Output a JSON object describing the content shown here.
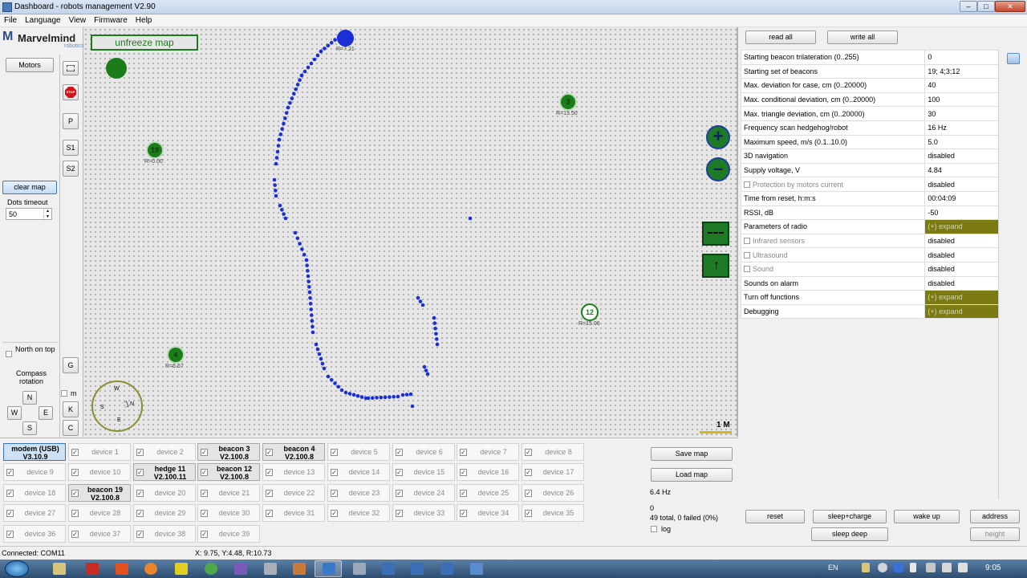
{
  "window": {
    "title": "Dashboard - robots management  V2.90",
    "min": "–",
    "max": "□",
    "close": "✕"
  },
  "menu": [
    "File",
    "Language",
    "View",
    "Firmware",
    "Help"
  ],
  "logo": {
    "m": "M",
    "name": "Marvelmind",
    "sub": "robotics"
  },
  "left": {
    "motors": "Motors",
    "stop": "STOP",
    "p": "P",
    "s1": "S1",
    "s2": "S2",
    "clear_map": "clear map",
    "dots_timeout_label": "Dots timeout",
    "dots_timeout_value": "50",
    "north_on_top": "North on top",
    "compass_rotation": "Compass rotation",
    "n": "N",
    "w": "W",
    "e": "E",
    "s": "S",
    "g": "G",
    "m": "m",
    "k": "K",
    "c": "C"
  },
  "map": {
    "unfreeze": "unfreeze map",
    "scale": "1 M",
    "compass": {
      "w": "W",
      "n": "N",
      "s": "S",
      "e": "E"
    },
    "beacons": [
      {
        "id": "19",
        "r": "R=0.00"
      },
      {
        "id": "3",
        "r": "R=13.50"
      },
      {
        "id": "4",
        "r": "R=6.67"
      },
      {
        "id": "12",
        "r": "R=15.06"
      }
    ],
    "hedge_r": "R=7.21"
  },
  "devices": {
    "modem": {
      "name": "modem (USB)",
      "ver": "V3.10.9"
    },
    "active": [
      {
        "name": "beacon 3",
        "ver": "V2.100.8"
      },
      {
        "name": "beacon 4",
        "ver": "V2.100.8"
      },
      {
        "name": "hedge 11",
        "ver": "V2.100.11"
      },
      {
        "name": "beacon 12",
        "ver": "V2.100.8"
      },
      {
        "name": "beacon 19",
        "ver": "V2.100.8"
      }
    ],
    "inactive": [
      "device 1",
      "device 2",
      "device 5",
      "device 6",
      "device 7",
      "device 8",
      "device 9",
      "device 10",
      "device 13",
      "device 14",
      "device 15",
      "device 16",
      "device 17",
      "device 18",
      "device 20",
      "device 21",
      "device 22",
      "device 23",
      "device 24",
      "device 25",
      "device 26",
      "device 27",
      "device 28",
      "device 29",
      "device 30",
      "device 31",
      "device 32",
      "device 33",
      "device 34",
      "device 35",
      "device 36",
      "device 37",
      "device 38",
      "device 39"
    ]
  },
  "mapctl": {
    "save": "Save map",
    "load": "Load map",
    "freq": "6.4 Hz",
    "count": "0",
    "stats": "49 total, 0 failed (0%)",
    "log": "log"
  },
  "right": {
    "read_all": "read all",
    "write_all": "write all",
    "params": [
      {
        "k": "Starting beacon trilateration (0..255)",
        "v": "0"
      },
      {
        "k": "Starting set of beacons",
        "v": "19;  4;3;12"
      },
      {
        "k": "Max. deviation for case, cm (0..20000)",
        "v": "40"
      },
      {
        "k": "Max. conditional deviation, cm (0..20000)",
        "v": "100"
      },
      {
        "k": "Max. triangle deviation, cm (0..20000)",
        "v": "30"
      },
      {
        "k": "Frequency scan hedgehog/robot",
        "v": "16 Hz"
      },
      {
        "k": "Maximum speed, m/s (0.1..10.0)",
        "v": "5.0"
      },
      {
        "k": "3D navigation",
        "v": "disabled"
      },
      {
        "k": "Supply voltage, V",
        "v": "4.84"
      },
      {
        "k": "Protection by motors current",
        "v": "disabled"
      },
      {
        "k": "Time from reset, h:m:s",
        "v": "00:04:09"
      },
      {
        "k": "RSSI, dB",
        "v": "-50"
      },
      {
        "k": "Parameters of radio",
        "v": "(+) expand"
      },
      {
        "k": "Infrared sensors",
        "v": "disabled"
      },
      {
        "k": "Ultrasound",
        "v": "disabled"
      },
      {
        "k": "Sound",
        "v": "disabled"
      },
      {
        "k": "Sounds on alarm",
        "v": "disabled"
      },
      {
        "k": "Turn off functions",
        "v": "(+) expand"
      },
      {
        "k": "Debugging",
        "v": "(+) expand"
      }
    ],
    "reset": "reset",
    "sleep_charge": "sleep+charge",
    "wake_up": "wake up",
    "address": "address",
    "sleep_deep": "sleep deep",
    "height": "height"
  },
  "status": {
    "connected": "Connected: COM11",
    "coords": "X: 9.75, Y:4.48, R:10.73"
  },
  "taskbar": {
    "lang": "EN",
    "time": "9:05"
  }
}
